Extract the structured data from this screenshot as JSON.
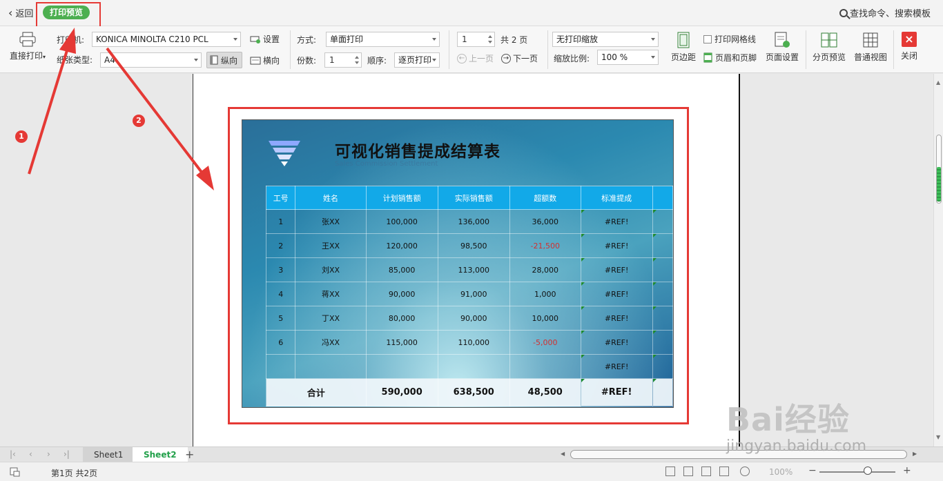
{
  "top": {
    "back_label": "返回",
    "preview_label": "打印预览",
    "search_label": "查找命令、搜索模板"
  },
  "toolbar": {
    "direct_print": "直接打印",
    "printer_label": "打印机:",
    "printer_value": "KONICA MINOLTA C210 PCL",
    "settings": "设置",
    "paper_label": "纸张类型:",
    "paper_value": "A4",
    "portrait": "纵向",
    "landscape": "横向",
    "mode_label": "方式:",
    "mode_value": "单面打印",
    "copies_label": "份数:",
    "copies_value": "1",
    "order_label": "顺序:",
    "order_value": "逐页打印",
    "page_value": "1",
    "total_pages": "共 2 页",
    "prev_page": "上一页",
    "next_page": "下一页",
    "scale_mode": "无打印缩放",
    "scale_label": "缩放比例:",
    "scale_value": "100 %",
    "margins": "页边距",
    "gridlines": "打印网格线",
    "header_footer": "页眉和页脚",
    "page_setup": "页面设置",
    "page_break_preview": "分页预览",
    "normal_view": "普通视图",
    "close": "关闭"
  },
  "sheet": {
    "title": "可视化销售提成结算表",
    "subtitle": "Sales Commission Settlement",
    "headers": [
      "工号",
      "姓名",
      "计划销售额",
      "实际销售额",
      "超额数",
      "标准提成"
    ],
    "rows": [
      [
        "1",
        "张XX",
        "100,000",
        "136,000",
        "36,000",
        "#REF!"
      ],
      [
        "2",
        "王XX",
        "120,000",
        "98,500",
        "-21,500",
        "#REF!"
      ],
      [
        "3",
        "刘XX",
        "85,000",
        "113,000",
        "28,000",
        "#REF!"
      ],
      [
        "4",
        "蒋XX",
        "90,000",
        "91,000",
        "1,000",
        "#REF!"
      ],
      [
        "5",
        "丁XX",
        "80,000",
        "90,000",
        "10,000",
        "#REF!"
      ],
      [
        "6",
        "冯XX",
        "115,000",
        "110,000",
        "-5,000",
        "#REF!"
      ],
      [
        "",
        "",
        "",
        "",
        "",
        "#REF!"
      ]
    ],
    "total": [
      "合计",
      "590,000",
      "638,500",
      "48,500",
      "#REF!"
    ],
    "negative_color": "#d32f2f",
    "header_color": "#12a9e8"
  },
  "annotations": {
    "badge1": "1",
    "badge2": "2",
    "color": "#e53935"
  },
  "tabs": [
    "Sheet1",
    "Sheet2"
  ],
  "status": {
    "page_info": "第1页 共2页",
    "zoom": "100%"
  },
  "watermark": {
    "brand": "Bai经验",
    "url": "jingyan.baidu.com"
  }
}
